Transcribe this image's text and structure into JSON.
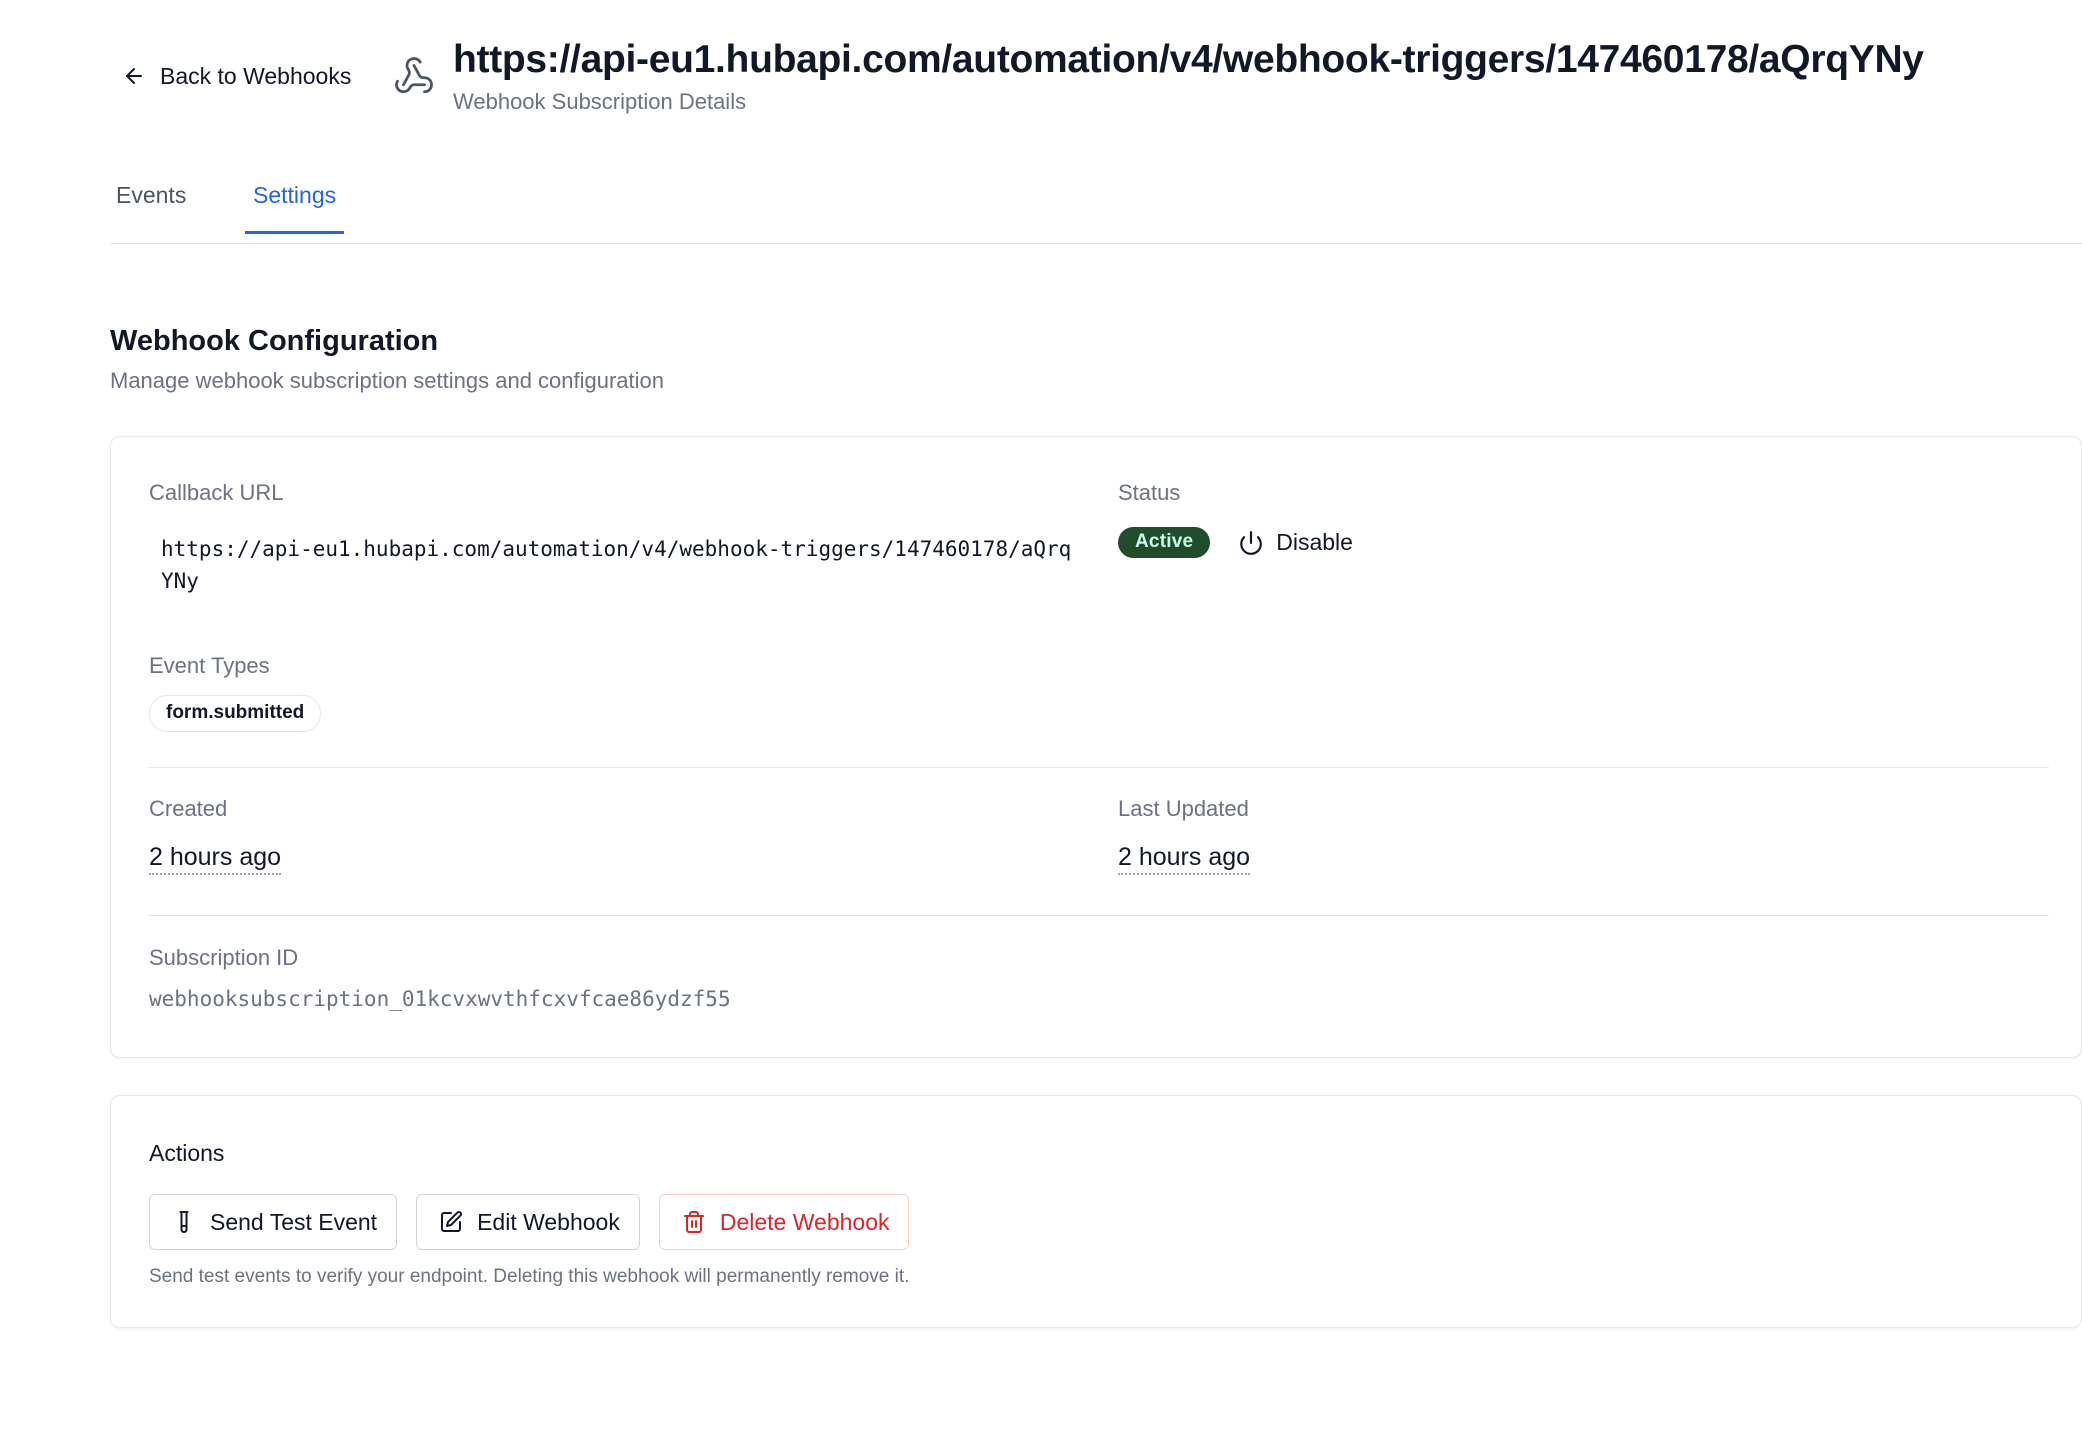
{
  "header": {
    "back_label": "Back to Webhooks",
    "back_icon": "arrow-left-icon",
    "app_icon": "webhook-icon",
    "title": "https://api-eu1.hubapi.com/automation/v4/webhook-triggers/147460178/aQrqYNy",
    "subtitle": "Webhook Subscription Details"
  },
  "tabs": [
    {
      "label": "Events",
      "active": false
    },
    {
      "label": "Settings",
      "active": true
    }
  ],
  "section": {
    "title": "Webhook Configuration",
    "description": "Manage webhook subscription settings and configuration"
  },
  "config": {
    "callback_url_label": "Callback URL",
    "callback_url": "https://api-eu1.hubapi.com/automation/v4/webhook-triggers/147460178/aQrqYNy",
    "status_label": "Status",
    "status_value": "Active",
    "status_color": "#1f4d2b",
    "disable_label": "Disable",
    "disable_icon": "power-icon",
    "event_types_label": "Event Types",
    "event_types": [
      "form.submitted"
    ],
    "created_label": "Created",
    "created_value": "2 hours ago",
    "updated_label": "Last Updated",
    "updated_value": "2 hours ago",
    "subscription_id_label": "Subscription ID",
    "subscription_id": "webhooksubscription_01kcvxwvthfcxvfcae86ydzf55"
  },
  "actions": {
    "title": "Actions",
    "send_test_label": "Send Test Event",
    "send_test_icon": "test-tube-icon",
    "edit_label": "Edit Webhook",
    "edit_icon": "edit-icon",
    "delete_label": "Delete Webhook",
    "delete_icon": "trash-icon",
    "danger_color": "#dc2626",
    "note": "Send test events to verify your endpoint. Deleting this webhook will permanently remove it."
  },
  "colors": {
    "accent": "#2563eb",
    "text": "#111827",
    "muted": "#6b7280"
  }
}
